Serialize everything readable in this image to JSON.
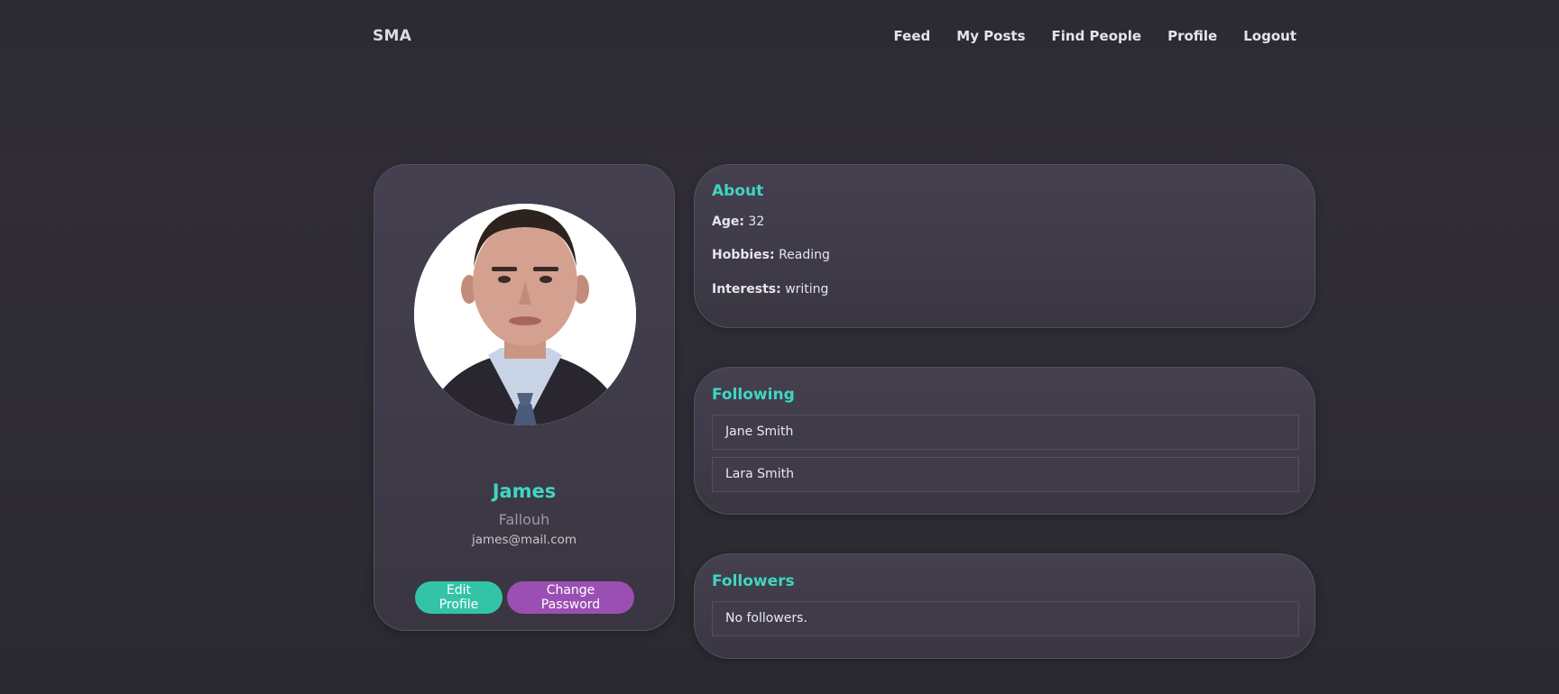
{
  "brand": "SMA",
  "nav": {
    "feed": "Feed",
    "my_posts": "My Posts",
    "find_people": "Find People",
    "profile": "Profile",
    "logout": "Logout"
  },
  "profile": {
    "first_name": "James",
    "last_name": "Fallouh",
    "email": "james@mail.com",
    "edit_label": "Edit Profile",
    "change_password_label": "Change Password"
  },
  "about": {
    "title": "About",
    "age_label": "Age:",
    "age_value": "32",
    "hobbies_label": "Hobbies:",
    "hobbies_value": "Reading",
    "interests_label": "Interests:",
    "interests_value": "writing"
  },
  "following": {
    "title": "Following",
    "items": [
      "Jane Smith",
      "Lara Smith"
    ]
  },
  "followers": {
    "title": "Followers",
    "empty_text": "No followers."
  },
  "colors": {
    "accent": "#3fd6c2",
    "edit_button": "#33c4a8",
    "password_button": "#9b4fb3"
  }
}
